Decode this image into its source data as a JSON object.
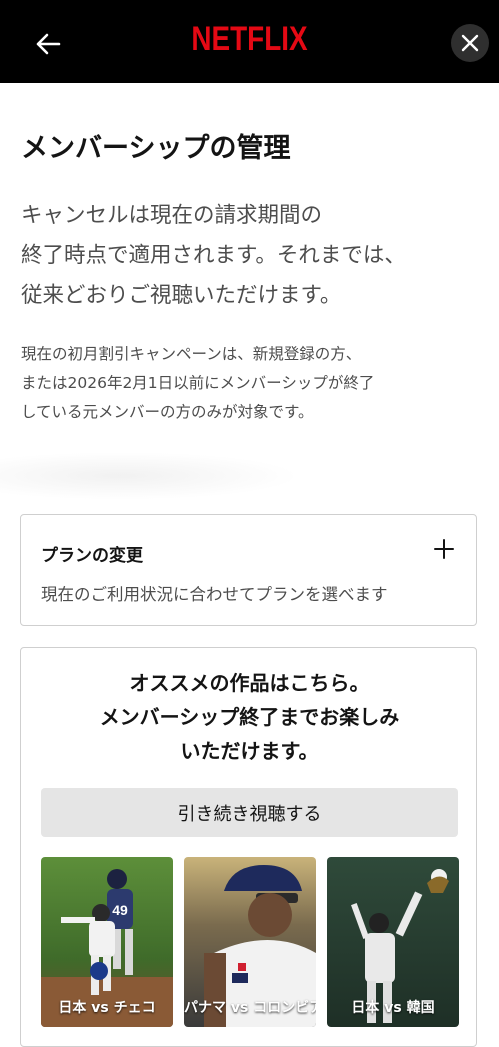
{
  "header": {
    "logo_text": "NETFLIX",
    "brand_color": "#e50914",
    "back_icon": "arrow-left-icon",
    "close_icon": "close-icon"
  },
  "page": {
    "title": "メンバーシップの管理",
    "lead_lines": [
      "キャンセルは現在の請求期間の",
      "終了時点で適用されます。それまでは、",
      "従来どおりご視聴いただけます。"
    ],
    "note_lines": [
      "現在の初月割引キャンペーンは、新規登録の方、",
      "または2026年2月1日以前にメンバーシップが終了",
      "している元メンバーの方のみが対象です。"
    ]
  },
  "plan_card": {
    "title": "プランの変更",
    "description": "現在のご利用状況に合わせてプランを選べます",
    "expand_icon": "plus-icon"
  },
  "recommend_card": {
    "heading_lines": [
      "オススメの作品はこちら。",
      "メンバーシップ終了までお楽しみ",
      "いただけます。"
    ],
    "continue_label": "引き続き視聴する",
    "thumbnails": [
      {
        "title": "日本 vs チェコ",
        "jersey_number": "49"
      },
      {
        "title": "パナマ vs コロンビア"
      },
      {
        "title": "日本 vs 韓国"
      }
    ]
  }
}
